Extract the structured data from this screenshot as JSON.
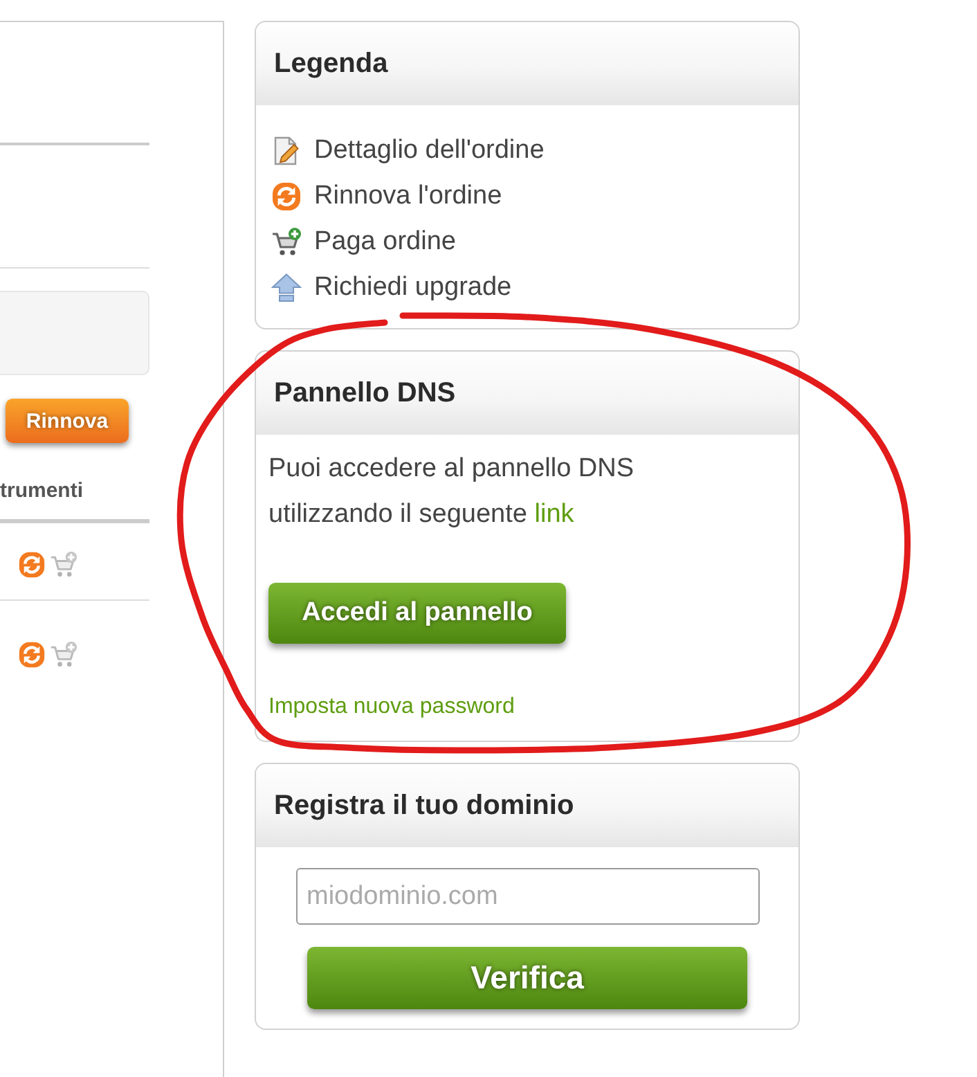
{
  "left_panel": {
    "renew_button": "Rinnova",
    "column_header": "trumenti",
    "rows": [
      {
        "actions": [
          {
            "kind": "renew",
            "disabled": false
          },
          {
            "kind": "pay",
            "disabled": true
          }
        ]
      },
      {
        "actions": [
          {
            "kind": "renew",
            "disabled": false
          },
          {
            "kind": "pay",
            "disabled": true
          }
        ]
      }
    ]
  },
  "legend": {
    "title": "Legenda",
    "items": [
      {
        "kind": "detail",
        "label": "Dettaglio dell'ordine"
      },
      {
        "kind": "renew",
        "label": "Rinnova l'ordine"
      },
      {
        "kind": "pay",
        "label": "Paga ordine"
      },
      {
        "kind": "upgrade",
        "label": "Richiedi upgrade"
      }
    ]
  },
  "dns_panel": {
    "title": "Pannello DNS",
    "text": "Puoi accedere al pannello DNS utilizzando il seguente",
    "link": "link",
    "button": "Accedi al pannello",
    "password_link": "Imposta nuova password"
  },
  "domain_panel": {
    "title": "Registra il tuo dominio",
    "search": {
      "placeholder": "miodominio.com"
    },
    "button": "Verifica"
  },
  "markup": [
    {
      "kind": "circle"
    }
  ]
}
